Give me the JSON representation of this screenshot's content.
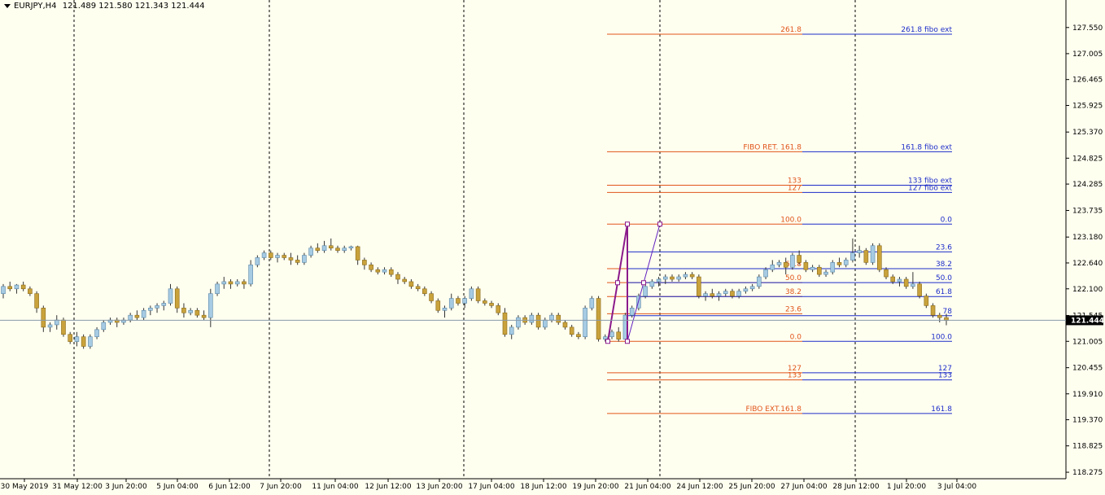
{
  "header": {
    "symbol": "EURJPY,H4",
    "ohlc": "121.489 121.580 121.343 121.444"
  },
  "current_price_label": "121.444",
  "colors": {
    "background": "#fffff0",
    "bull": "#a6cbe3",
    "bear": "#c9a23c",
    "fibo_ret": "#e0541a",
    "fibo_ext": "#1c2cc8",
    "trend": "#8b1a8b",
    "trend_thin": "#6020c0",
    "price_line": "#8799a8"
  },
  "chart_data": {
    "type": "candlestick",
    "timeframe": "H4",
    "ylim": [
      118.275,
      128.0
    ],
    "y_ticks": [
      "127.550",
      "127.005",
      "126.465",
      "125.925",
      "125.370",
      "124.825",
      "124.285",
      "123.735",
      "123.180",
      "122.640",
      "122.100",
      "121.545",
      "121.005",
      "120.455",
      "119.910",
      "119.370",
      "118.825",
      "118.275"
    ],
    "x_ticks": [
      "30 May 2019",
      "31 May 12:00",
      "3 Jun 20:00",
      "5 Jun 04:00",
      "6 Jun 12:00",
      "7 Jun 20:00",
      "11 Jun 04:00",
      "12 Jun 12:00",
      "13 Jun 20:00",
      "17 Jun 04:00",
      "18 Jun 12:00",
      "19 Jun 20:00",
      "21 Jun 04:00",
      "24 Jun 12:00",
      "25 Jun 20:00",
      "27 Jun 04:00",
      "28 Jun 12:00",
      "1 Jul 20:00",
      "3 Jul 04:00"
    ],
    "candles": [
      [
        122.0,
        122.2,
        121.9,
        122.15
      ],
      [
        122.15,
        122.25,
        122.05,
        122.1
      ],
      [
        122.1,
        122.2,
        122.0,
        122.18
      ],
      [
        122.18,
        122.25,
        122.05,
        122.1
      ],
      [
        122.1,
        122.15,
        121.95,
        122.0
      ],
      [
        122.0,
        122.05,
        121.6,
        121.7
      ],
      [
        121.7,
        121.75,
        121.2,
        121.3
      ],
      [
        121.3,
        121.4,
        121.2,
        121.35
      ],
      [
        121.35,
        121.55,
        121.25,
        121.45
      ],
      [
        121.45,
        121.5,
        121.1,
        121.15
      ],
      [
        121.15,
        121.2,
        120.95,
        121.0
      ],
      [
        121.0,
        121.2,
        120.9,
        121.1
      ],
      [
        121.1,
        121.15,
        120.85,
        120.9
      ],
      [
        120.9,
        121.15,
        120.85,
        121.1
      ],
      [
        121.1,
        121.3,
        121.05,
        121.25
      ],
      [
        121.25,
        121.45,
        121.2,
        121.4
      ],
      [
        121.4,
        121.5,
        121.35,
        121.45
      ],
      [
        121.45,
        121.5,
        121.3,
        121.4
      ],
      [
        121.4,
        121.5,
        121.35,
        121.45
      ],
      [
        121.45,
        121.6,
        121.4,
        121.55
      ],
      [
        121.55,
        121.65,
        121.45,
        121.5
      ],
      [
        121.5,
        121.7,
        121.45,
        121.65
      ],
      [
        121.65,
        121.75,
        121.55,
        121.7
      ],
      [
        121.7,
        121.8,
        121.6,
        121.75
      ],
      [
        121.75,
        121.85,
        121.65,
        121.8
      ],
      [
        121.8,
        122.2,
        121.75,
        122.1
      ],
      [
        122.1,
        122.15,
        121.6,
        121.7
      ],
      [
        121.7,
        121.8,
        121.5,
        121.6
      ],
      [
        121.6,
        121.7,
        121.55,
        121.65
      ],
      [
        121.65,
        121.7,
        121.5,
        121.55
      ],
      [
        121.55,
        121.65,
        121.45,
        121.5
      ],
      [
        121.5,
        122.1,
        121.3,
        122.0
      ],
      [
        122.0,
        122.25,
        121.95,
        122.2
      ],
      [
        122.2,
        122.35,
        122.1,
        122.25
      ],
      [
        122.25,
        122.3,
        122.1,
        122.2
      ],
      [
        122.2,
        122.3,
        122.15,
        122.25
      ],
      [
        122.25,
        122.3,
        122.1,
        122.2
      ],
      [
        122.2,
        122.7,
        122.15,
        122.6
      ],
      [
        122.6,
        122.8,
        122.55,
        122.75
      ],
      [
        122.75,
        122.9,
        122.7,
        122.85
      ],
      [
        122.85,
        122.9,
        122.7,
        122.75
      ],
      [
        122.75,
        122.85,
        122.65,
        122.8
      ],
      [
        122.8,
        122.85,
        122.7,
        122.75
      ],
      [
        122.75,
        122.85,
        122.6,
        122.7
      ],
      [
        122.7,
        122.8,
        122.6,
        122.65
      ],
      [
        122.65,
        122.85,
        122.6,
        122.8
      ],
      [
        122.8,
        123.0,
        122.75,
        122.95
      ],
      [
        122.95,
        123.05,
        122.85,
        122.9
      ],
      [
        122.9,
        123.1,
        122.85,
        123.0
      ],
      [
        123.0,
        123.15,
        122.9,
        122.95
      ],
      [
        122.95,
        123.0,
        122.85,
        122.9
      ],
      [
        122.9,
        123.0,
        122.85,
        122.95
      ],
      [
        122.95,
        123.0,
        122.9,
        122.98
      ],
      [
        122.98,
        123.0,
        122.6,
        122.7
      ],
      [
        122.7,
        122.75,
        122.5,
        122.6
      ],
      [
        122.6,
        122.65,
        122.45,
        122.5
      ],
      [
        122.5,
        122.55,
        122.4,
        122.45
      ],
      [
        122.45,
        122.55,
        122.4,
        122.5
      ],
      [
        122.5,
        122.55,
        122.35,
        122.4
      ],
      [
        122.4,
        122.45,
        122.2,
        122.3
      ],
      [
        122.3,
        122.35,
        122.2,
        122.25
      ],
      [
        122.25,
        122.3,
        122.1,
        122.15
      ],
      [
        122.15,
        122.2,
        122.05,
        122.1
      ],
      [
        122.1,
        122.15,
        121.95,
        122.0
      ],
      [
        122.0,
        122.05,
        121.8,
        121.85
      ],
      [
        121.85,
        121.9,
        121.6,
        121.65
      ],
      [
        121.65,
        121.75,
        121.5,
        121.7
      ],
      [
        121.7,
        122.0,
        121.65,
        121.9
      ],
      [
        121.9,
        121.95,
        121.75,
        121.8
      ],
      [
        121.8,
        121.95,
        121.7,
        121.9
      ],
      [
        121.9,
        122.15,
        121.85,
        122.1
      ],
      [
        122.1,
        122.15,
        121.8,
        121.85
      ],
      [
        121.85,
        121.9,
        121.75,
        121.8
      ],
      [
        121.8,
        121.85,
        121.7,
        121.75
      ],
      [
        121.75,
        121.8,
        121.55,
        121.6
      ],
      [
        121.6,
        121.7,
        121.1,
        121.15
      ],
      [
        121.15,
        121.35,
        121.05,
        121.3
      ],
      [
        121.3,
        121.55,
        121.25,
        121.5
      ],
      [
        121.5,
        121.55,
        121.35,
        121.4
      ],
      [
        121.4,
        121.6,
        121.35,
        121.55
      ],
      [
        121.55,
        121.6,
        121.25,
        121.3
      ],
      [
        121.3,
        121.5,
        121.25,
        121.45
      ],
      [
        121.45,
        121.6,
        121.4,
        121.55
      ],
      [
        121.55,
        121.6,
        121.35,
        121.4
      ],
      [
        121.4,
        121.45,
        121.25,
        121.3
      ],
      [
        121.3,
        121.35,
        121.1,
        121.15
      ],
      [
        121.15,
        121.2,
        121.05,
        121.1
      ],
      [
        121.1,
        121.75,
        121.05,
        121.7
      ],
      [
        121.7,
        121.95,
        121.65,
        121.9
      ],
      [
        121.9,
        121.95,
        121.0,
        121.05
      ],
      [
        121.05,
        121.15,
        121.0,
        121.1
      ],
      [
        121.1,
        121.25,
        121.05,
        121.2
      ],
      [
        121.2,
        121.3,
        121.0,
        121.05
      ],
      [
        121.05,
        121.6,
        121.0,
        121.55
      ],
      [
        121.55,
        121.75,
        121.5,
        121.7
      ],
      [
        121.7,
        122.0,
        121.65,
        121.95
      ],
      [
        121.95,
        122.2,
        121.9,
        122.15
      ],
      [
        122.15,
        122.3,
        122.1,
        122.25
      ],
      [
        122.25,
        122.35,
        122.15,
        122.3
      ],
      [
        122.3,
        122.4,
        122.2,
        122.35
      ],
      [
        122.35,
        122.4,
        122.25,
        122.3
      ],
      [
        122.3,
        122.4,
        122.25,
        122.35
      ],
      [
        122.35,
        122.45,
        122.3,
        122.4
      ],
      [
        122.4,
        122.45,
        122.3,
        122.35
      ],
      [
        122.35,
        122.4,
        121.9,
        121.95
      ],
      [
        121.95,
        122.05,
        121.85,
        122.0
      ],
      [
        122.0,
        122.1,
        121.9,
        121.95
      ],
      [
        121.95,
        122.05,
        121.85,
        122.0
      ],
      [
        122.0,
        122.1,
        121.95,
        122.05
      ],
      [
        122.05,
        122.1,
        121.9,
        121.95
      ],
      [
        121.95,
        122.1,
        121.9,
        122.05
      ],
      [
        122.05,
        122.15,
        122.0,
        122.1
      ],
      [
        122.1,
        122.2,
        122.05,
        122.15
      ],
      [
        122.15,
        122.4,
        122.1,
        122.35
      ],
      [
        122.35,
        122.55,
        122.3,
        122.5
      ],
      [
        122.5,
        122.7,
        122.45,
        122.6
      ],
      [
        122.6,
        122.7,
        122.55,
        122.65
      ],
      [
        122.65,
        122.75,
        122.4,
        122.55
      ],
      [
        122.55,
        122.85,
        122.5,
        122.8
      ],
      [
        122.8,
        122.9,
        122.6,
        122.65
      ],
      [
        122.65,
        122.7,
        122.45,
        122.5
      ],
      [
        122.5,
        122.6,
        122.45,
        122.55
      ],
      [
        122.55,
        122.6,
        122.35,
        122.4
      ],
      [
        122.4,
        122.5,
        122.35,
        122.45
      ],
      [
        122.45,
        122.7,
        122.4,
        122.65
      ],
      [
        122.65,
        122.75,
        122.55,
        122.6
      ],
      [
        122.6,
        122.75,
        122.55,
        122.7
      ],
      [
        122.7,
        123.15,
        122.65,
        122.85
      ],
      [
        122.85,
        123.0,
        122.75,
        122.9
      ],
      [
        122.9,
        122.95,
        122.6,
        122.65
      ],
      [
        122.65,
        123.05,
        122.6,
        123.0
      ],
      [
        123.0,
        123.05,
        122.45,
        122.5
      ],
      [
        122.5,
        122.55,
        122.3,
        122.35
      ],
      [
        122.35,
        122.4,
        122.2,
        122.25
      ],
      [
        122.25,
        122.35,
        122.15,
        122.3
      ],
      [
        122.3,
        122.35,
        122.1,
        122.15
      ],
      [
        122.15,
        122.45,
        122.1,
        122.2
      ],
      [
        122.2,
        122.25,
        121.9,
        121.95
      ],
      [
        121.95,
        122.0,
        121.7,
        121.75
      ],
      [
        121.75,
        121.8,
        121.5,
        121.55
      ],
      [
        121.55,
        121.6,
        121.4,
        121.5
      ],
      [
        121.5,
        121.58,
        121.34,
        121.44
      ]
    ],
    "fibo_retracement": {
      "swing_low": 121.005,
      "swing_high": 123.45,
      "levels": [
        {
          "label": "261.8",
          "price": 127.41
        },
        {
          "label": "FIBO RET. 161.8",
          "price": 124.96
        },
        {
          "label": "133",
          "price": 124.26
        },
        {
          "label": "127",
          "price": 124.11
        },
        {
          "label": "100.0",
          "price": 123.45
        },
        {
          "label": "61.8",
          "price": 122.52
        },
        {
          "label": "50.0",
          "price": 122.23
        },
        {
          "label": "38.2",
          "price": 121.94
        },
        {
          "label": "23.6",
          "price": 121.58
        },
        {
          "label": "0.0",
          "price": 121.005
        },
        {
          "label": "127",
          "price": 120.35
        },
        {
          "label": "133",
          "price": 120.2
        },
        {
          "label": "FIBO EXT.161.8",
          "price": 119.5
        }
      ]
    },
    "fibo_extension": {
      "levels": [
        {
          "label": "261.8 fibo ext",
          "price": 127.41
        },
        {
          "label": "161.8 fibo ext",
          "price": 124.96
        },
        {
          "label": "133 fibo ext",
          "price": 124.26
        },
        {
          "label": "127 fibo ext",
          "price": 124.11
        },
        {
          "label": "0.0",
          "price": 123.45
        },
        {
          "label": "23.6",
          "price": 122.87
        },
        {
          "label": "38.2",
          "price": 122.52
        },
        {
          "label": "50.0",
          "price": 122.23
        },
        {
          "label": "61.8",
          "price": 121.94
        },
        {
          "label": "78",
          "price": 121.54
        },
        {
          "label": "100.0",
          "price": 121.005
        },
        {
          "label": "127",
          "price": 120.35
        },
        {
          "label": "133",
          "price": 120.2
        },
        {
          "label": "161.8",
          "price": 119.5
        }
      ]
    }
  }
}
